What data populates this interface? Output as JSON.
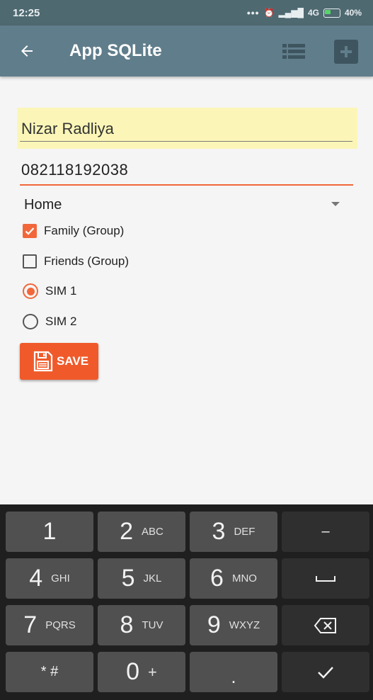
{
  "status_bar": {
    "time": "12:25",
    "signal_text": "4G",
    "battery": "40%"
  },
  "app_bar": {
    "title": "App SQLite",
    "back_icon": "arrow-left-icon",
    "list_icon": "list-icon",
    "add_icon": "plus-icon"
  },
  "form": {
    "name_value": "Nizar Radliya",
    "phone_value": "082118192038",
    "select_value": "Home",
    "checkboxes": [
      {
        "label": "Family (Group)",
        "checked": true
      },
      {
        "label": "Friends (Group)",
        "checked": false
      }
    ],
    "radios": [
      {
        "label": "SIM 1",
        "checked": true
      },
      {
        "label": "SIM 2",
        "checked": false
      }
    ],
    "save_label": "SAVE"
  },
  "keyboard": {
    "keys": [
      {
        "main": "1",
        "sub": ""
      },
      {
        "main": "2",
        "sub": "ABC"
      },
      {
        "main": "3",
        "sub": "DEF"
      },
      {
        "main": "–",
        "sub": ""
      },
      {
        "main": "4",
        "sub": "GHI"
      },
      {
        "main": "5",
        "sub": "JKL"
      },
      {
        "main": "6",
        "sub": "MNO"
      },
      {
        "main": "␣",
        "sub": ""
      },
      {
        "main": "7",
        "sub": "PQRS"
      },
      {
        "main": "8",
        "sub": "TUV"
      },
      {
        "main": "9",
        "sub": "WXYZ"
      },
      {
        "main": "⌫",
        "sub": ""
      },
      {
        "main": "* #",
        "sub": ""
      },
      {
        "main": "0",
        "sub": "+"
      },
      {
        "main": ".",
        "sub": ""
      },
      {
        "main": "✓",
        "sub": ""
      }
    ]
  },
  "colors": {
    "status_bar": "#4f6971",
    "app_bar": "#607d8b",
    "accent": "#f2673a",
    "name_highlight": "#fbf6b7"
  }
}
